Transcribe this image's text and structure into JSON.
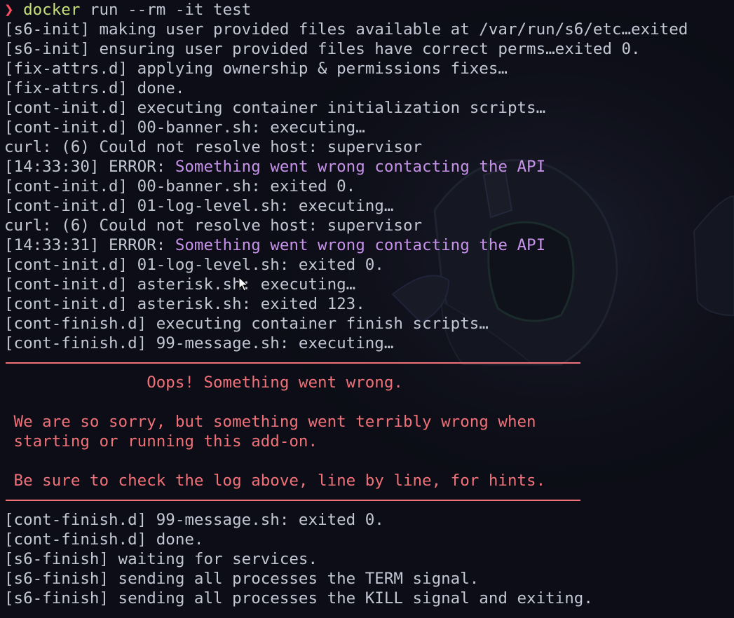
{
  "prompt": {
    "arrow": "❯",
    "command": "docker",
    "args": " run --rm -it test"
  },
  "log_lines_top": [
    "[s6-init] making user provided files available at /var/run/s6/etc…exited",
    "[s6-init] ensuring user provided files have correct perms…exited 0.",
    "[fix-attrs.d] applying ownership & permissions fixes…",
    "[fix-attrs.d] done.",
    "[cont-init.d] executing container initialization scripts…",
    "[cont-init.d] 00-banner.sh: executing…",
    "curl: (6) Could not resolve host: supervisor"
  ],
  "error_1": {
    "prefix": "[14:33:30] ERROR: ",
    "message": "Something went wrong contacting the API"
  },
  "log_lines_mid": [
    "[cont-init.d] 00-banner.sh: exited 0.",
    "[cont-init.d] 01-log-level.sh: executing…",
    "curl: (6) Could not resolve host: supervisor"
  ],
  "error_2": {
    "prefix": "[14:33:31] ERROR: ",
    "message": "Something went wrong contacting the API"
  },
  "log_lines_after": [
    "[cont-init.d] 01-log-level.sh: exited 0.",
    "[cont-init.d] asterisk.sh: executing…",
    "[cont-init.d] asterisk.sh: exited 123.",
    "[cont-finish.d] executing container finish scripts…",
    "[cont-finish.d] 99-message.sh: executing…"
  ],
  "banner": {
    "title": "               Oops! Something went wrong.",
    "body_1": " We are so sorry, but something went terribly wrong when",
    "body_2": " starting or running this add-on.",
    "hint": " Be sure to check the log above, line by line, for hints."
  },
  "log_lines_bottom": [
    "[cont-finish.d] 99-message.sh: exited 0.",
    "[cont-finish.d] done.",
    "[s6-finish] waiting for services.",
    "[s6-finish] sending all processes the TERM signal.",
    "[s6-finish] sending all processes the KILL signal and exiting."
  ],
  "colors": {
    "background": "#0c0d16",
    "text": "#c3c7d4",
    "prompt_arrow": "#ff4d5e",
    "command": "#c8e07a",
    "error_message": "#c792ea",
    "banner": "#f07178"
  }
}
